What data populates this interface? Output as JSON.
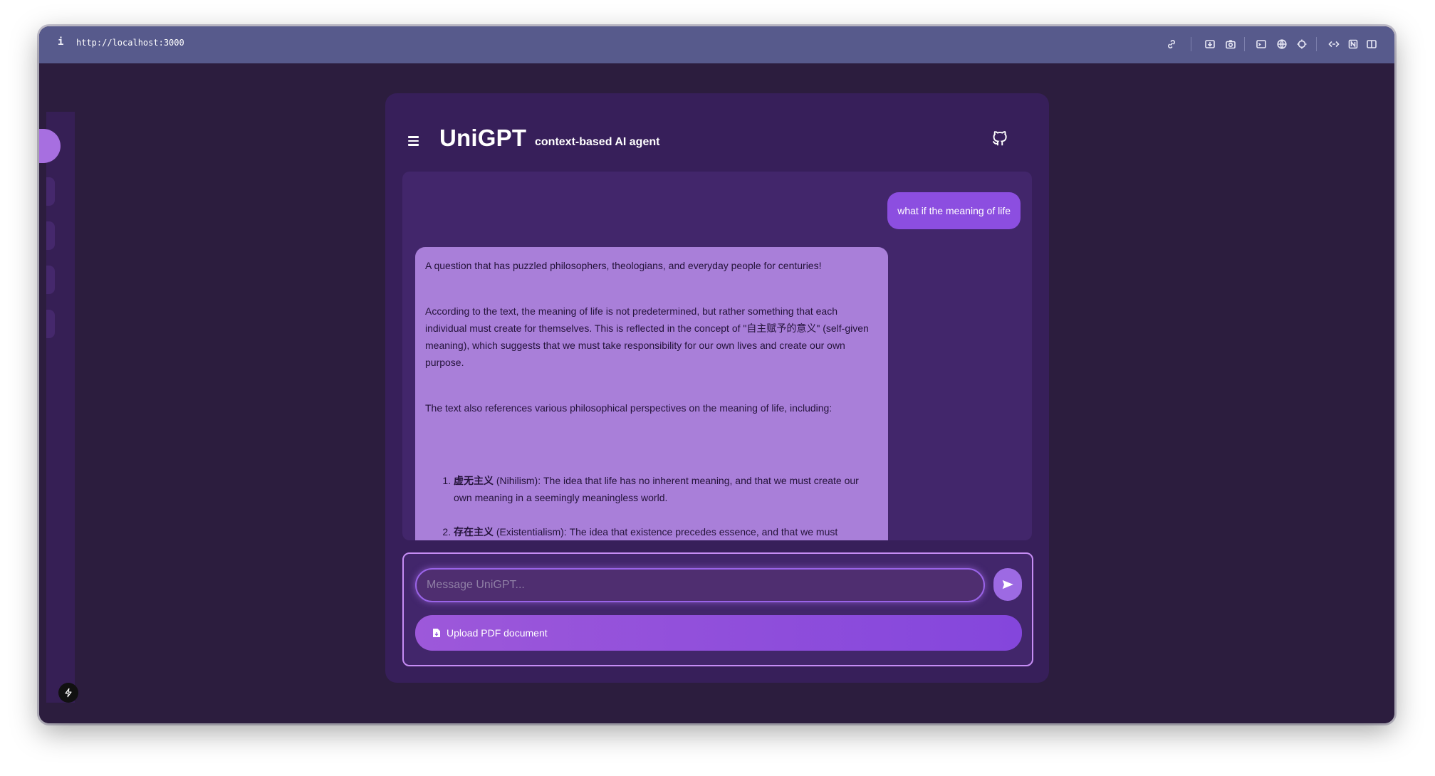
{
  "browser": {
    "info_glyph": "i",
    "url": "http://localhost:3000"
  },
  "toolbar_icons": [
    "link-icon",
    "download-icon",
    "camera-icon",
    "terminal-icon",
    "globe-icon",
    "crosshair-icon",
    "code-icon",
    "notion-icon",
    "split-view-icon"
  ],
  "header": {
    "title": "UniGPT",
    "tagline": "context-based AI agent"
  },
  "chat": {
    "user_message": "what if the meaning of life",
    "assistant": {
      "p1": "A question that has puzzled philosophers, theologians, and everyday people for centuries!",
      "p2": "According to the text, the meaning of life is not predetermined, but rather something that each individual must create for themselves. This is reflected in the concept of \"自主赋予的意义\" (self-given meaning), which suggests that we must take responsibility for our own lives and create our own purpose.",
      "p3": "The text also references various philosophical perspectives on the meaning of life, including:",
      "list": [
        {
          "term": "虚无主义",
          "text": " (Nihilism): The idea that life has no inherent meaning, and that we must create our own meaning in a seemingly meaningless world."
        },
        {
          "term": "存在主义",
          "text": " (Existentialism): The idea that existence precedes essence, and that we must"
        }
      ]
    }
  },
  "composer": {
    "placeholder": "Message UniGPT...",
    "upload_label": "Upload PDF document"
  },
  "colors": {
    "accent": "#8c4ee0",
    "card": "#371f5a",
    "chat_panel": "#42266b",
    "assistant_bubble": "#a97fd9"
  }
}
